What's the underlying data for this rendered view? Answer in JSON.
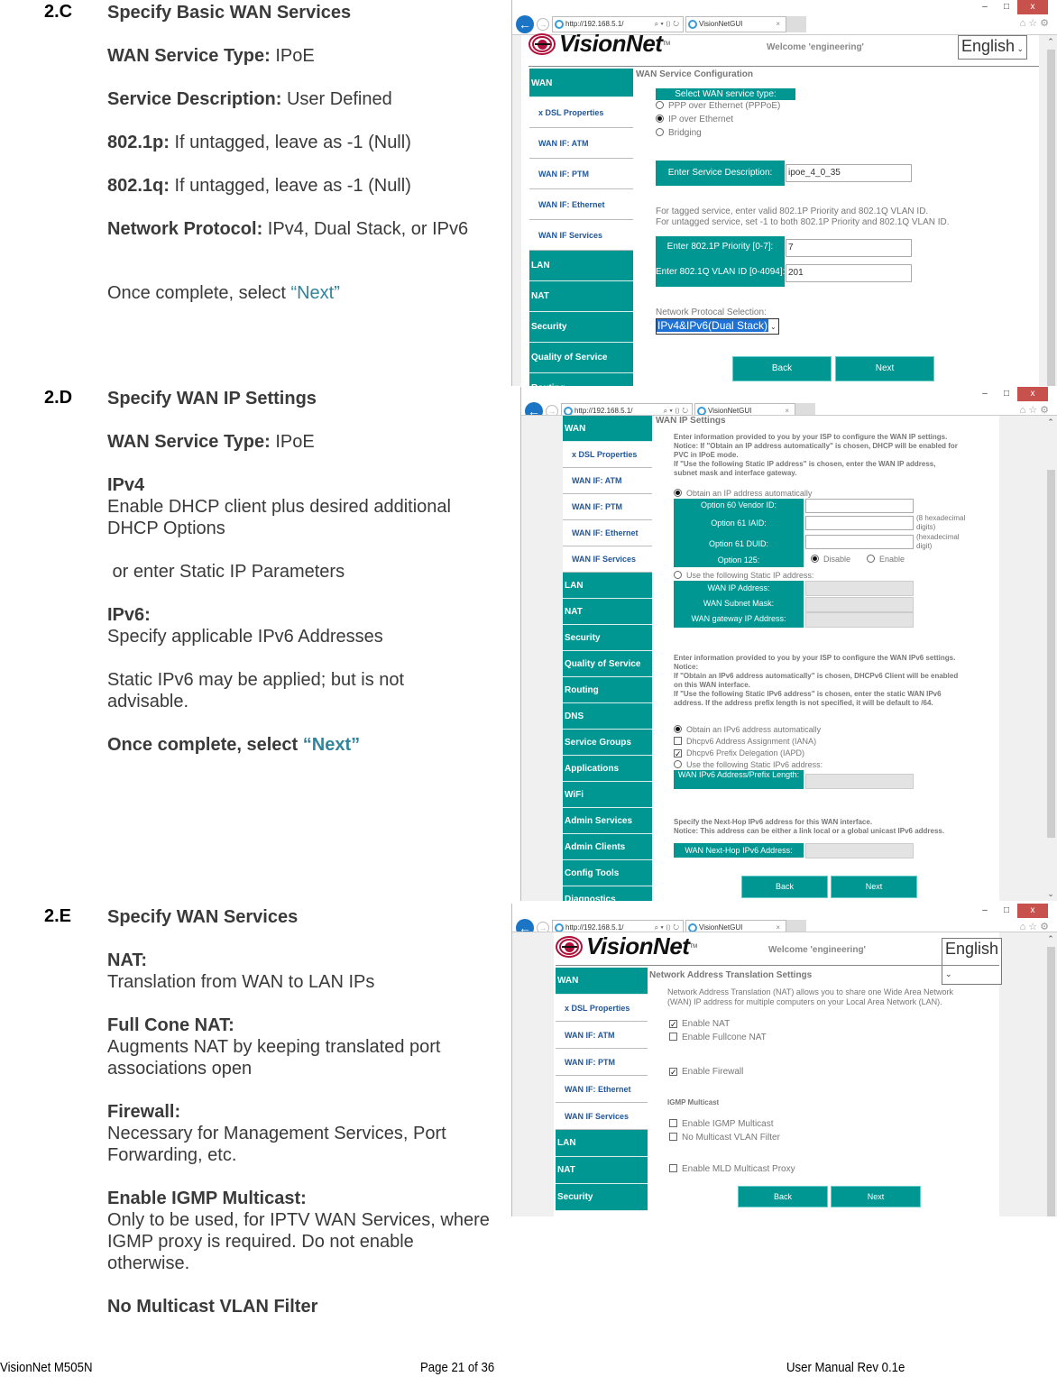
{
  "sections": [
    {
      "number": "2.C",
      "title": "Specify Basic WAN Services",
      "fields": [
        {
          "label": "WAN Service Type:",
          "value": " IPoE"
        },
        {
          "label": "Service Description:",
          "value": " User Defined"
        },
        {
          "label": "802.1p:",
          "value": " If untagged, leave as -1 (Null)"
        },
        {
          "label": "802.1q:",
          "value": " If untagged, leave as -1 (Null)"
        },
        {
          "label": "Network Protocol:",
          "value": " IPv4, Dual Stack, or IPv6"
        }
      ],
      "closing_text": "Once complete, select ",
      "closing_link": "“Next”"
    },
    {
      "number": "2.D",
      "title": "Specify WAN IP Settings",
      "service_type_label": "WAN Service Type:",
      "service_type_value": " IPoE",
      "ipv4_heading": "IPv4",
      "ipv4_text": "Enable DHCP client plus desired additional DHCP Options",
      "ipv4_alt": " or enter Static IP Parameters",
      "ipv6_heading": "IPv6:",
      "ipv6_text": "Specify applicable IPv6 Addresses",
      "ipv6_note": "Static IPv6 may be applied; but is not advisable.",
      "closing_text": "Once complete, select ",
      "closing_link": "“Next”"
    },
    {
      "number": "2.E",
      "title": "Specify WAN Services",
      "items": [
        {
          "heading": "NAT:",
          "text": "Translation from WAN to LAN IPs"
        },
        {
          "heading": "Full Cone NAT:",
          "text": "Augments NAT by keeping translated port associations open"
        },
        {
          "heading": "Firewall:",
          "text": "Necessary for Management Services, Port Forwarding, etc."
        },
        {
          "heading": "Enable IGMP Multicast:",
          "text": "Only to be used, for IPTV WAN Services, where IGMP proxy is required. Do not enable otherwise."
        },
        {
          "heading": "No Multicast VLAN Filter",
          "text": ""
        }
      ]
    }
  ],
  "footer": {
    "left": "VisionNet   M505N",
    "center": "Page 21 of 36",
    "right": "User Manual Rev 0.1e"
  },
  "browser": {
    "url": "http://192.168.5.1/",
    "tab_title": "VisionNetGUI",
    "tab_close": "×",
    "minimize": "–",
    "maximize": "□",
    "close": "x",
    "back": "←",
    "forward": "→",
    "addr_tools": "⌕ ▾ ▯ ↻",
    "right_icons": "⌂☆⚙",
    "scroll_up": "⌃",
    "scroll_down": "⌄"
  },
  "gui": {
    "brand": "VisionNet",
    "tm": "TM",
    "welcome": "Welcome 'engineering'",
    "language": "English",
    "back_label": "Back",
    "next_label": "Next"
  },
  "shot1": {
    "sidebar": [
      "WAN",
      "x DSL Properties",
      "WAN IF: ATM",
      "WAN IF: PTM",
      "WAN IF: Ethernet",
      "WAN IF Services",
      "LAN",
      "NAT",
      "Security",
      "Quality of Service",
      "Routing"
    ],
    "title": "WAN Service Configuration",
    "select_type_label": "Select WAN service type:",
    "service_types": [
      {
        "label": "PPP over Ethernet (PPPoE)",
        "selected": false
      },
      {
        "label": "IP over Ethernet",
        "selected": true
      },
      {
        "label": "Bridging",
        "selected": false
      }
    ],
    "service_desc_label": "Enter Service Description:",
    "service_desc_value": "ipoe_4_0_35",
    "tag_note_1": "For tagged service, enter valid 802.1P Priority and 802.1Q VLAN ID.",
    "tag_note_2": "For untagged service, set -1 to both 802.1P Priority and 802.1Q VLAN ID.",
    "priority_label": "Enter 802.1P Priority [0-7]:",
    "priority_value": "7",
    "vlan_label": "Enter 802.1Q VLAN ID [0-4094]:",
    "vlan_value": "201",
    "protocol_label": "Network Protocal Selection:",
    "protocol_value": "IPv4&IPv6(Dual Stack)"
  },
  "shot2": {
    "sidebar": [
      "WAN",
      "x DSL Properties",
      "WAN IF: ATM",
      "WAN IF: PTM",
      "WAN IF: Ethernet",
      "WAN IF Services",
      "LAN",
      "NAT",
      "Security",
      "Quality of Service",
      "Routing",
      "DNS",
      "Service Groups",
      "Applications",
      "WiFi",
      "Admin Services",
      "Admin Clients",
      "Config Tools",
      "Diagnostics"
    ],
    "title": "WAN IP Settings",
    "intro": [
      "Enter information provided to you by your ISP to configure the WAN IP settings.",
      "Notice: If \"Obtain an IP address automatically\" is chosen, DHCP will be enabled for",
      "PVC in IPoE mode.",
      "If \"Use the following Static IP address\" is chosen, enter the WAN IP address,",
      "subnet mask and interface gateway."
    ],
    "obtain_auto": "Obtain an IP address automatically",
    "opt60_label": "Option 60 Vendor ID:",
    "opt61iaid_label": "Option 61 IAID:",
    "opt61iaid_hint": "(8 hexadecimal digits)",
    "opt61duid_label": "Option 61 DUID:",
    "opt61duid_hint": "(hexadecimal digit)",
    "opt125_label": "Option 125:",
    "opt125_disable": "Disable",
    "opt125_enable": "Enable",
    "static_label": "Use the following Static IP address:",
    "wan_ip_label": "WAN IP Address:",
    "subnet_label": "WAN Subnet Mask:",
    "gateway_label": "WAN gateway IP Address:",
    "ipv6_intro": [
      "Enter information provided to you by your ISP to configure the WAN IPv6 settings.",
      "Notice:",
      "If \"Obtain an IPv6 address automatically\" is chosen, DHCPv6 Client will be enabled",
      "on this WAN interface.",
      "If \"Use the following Static IPv6 address\" is chosen, enter the static WAN IPv6",
      "address. If the address prefix length is not specified, it will be default to /64."
    ],
    "ipv6_auto": "Obtain an IPv6 address automatically",
    "iana_label": "Dhcpv6 Address Assignment (IANA)",
    "iana_checked": false,
    "iapd_label": "Dhcpv6 Prefix Delegation (IAPD)",
    "iapd_checked": true,
    "ipv6_static_label": "Use the following Static IPv6 address:",
    "ipv6_addr_label": "WAN IPv6 Address/Prefix Length:",
    "nexthop_note_1": "Specify the Next-Hop IPv6 address for this WAN interface.",
    "nexthop_note_2": "Notice: This address can be either a link local or a global unicast IPv6 address.",
    "nexthop_label": "WAN Next-Hop IPv6 Address:"
  },
  "shot3": {
    "sidebar": [
      "WAN",
      "x DSL Properties",
      "WAN IF: ATM",
      "WAN IF: PTM",
      "WAN IF: Ethernet",
      "WAN IF Services",
      "LAN",
      "NAT",
      "Security"
    ],
    "title": "Network Address Translation Settings",
    "intro_1": "Network Address Translation (NAT) allows you to share one Wide Area Network",
    "intro_2": "(WAN) IP address for multiple computers on your Local Area Network (LAN).",
    "checks": [
      {
        "label": "Enable NAT",
        "checked": true
      },
      {
        "label": "Enable Fullcone NAT",
        "checked": false
      },
      {
        "label": "Enable Firewall",
        "checked": true
      }
    ],
    "igmp_title": "IGMP Multicast",
    "igmp_checks": [
      {
        "label": "Enable IGMP Multicast",
        "checked": false
      },
      {
        "label": "No Multicast VLAN Filter",
        "checked": false
      },
      {
        "label": "Enable MLD Multicast Proxy",
        "checked": false
      }
    ]
  },
  "check_mark": "✓"
}
